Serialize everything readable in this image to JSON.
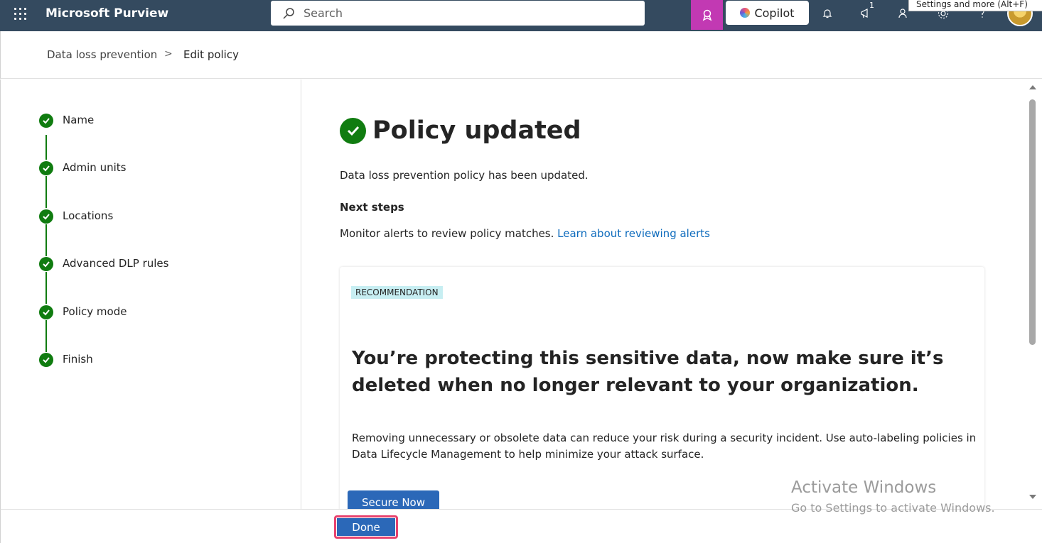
{
  "app": {
    "title": "Microsoft Purview"
  },
  "search": {
    "placeholder": "Search"
  },
  "topbar": {
    "copilot_label": "Copilot",
    "notifications_badge": "1",
    "settings_tooltip": "Settings and more (Alt+F)"
  },
  "breadcrumb": {
    "parent": "Data loss prevention",
    "separator": ">",
    "current": "Edit policy"
  },
  "steps": [
    {
      "label": "Name",
      "status": "complete"
    },
    {
      "label": "Admin units",
      "status": "complete"
    },
    {
      "label": "Locations",
      "status": "complete"
    },
    {
      "label": "Advanced DLP rules",
      "status": "complete"
    },
    {
      "label": "Policy mode",
      "status": "complete"
    },
    {
      "label": "Finish",
      "status": "complete"
    }
  ],
  "main": {
    "title": "Policy updated",
    "updated_text": "Data loss prevention policy has been updated.",
    "next_steps_heading": "Next steps",
    "monitor_text": "Monitor alerts to review policy matches.",
    "monitor_link": "Learn about reviewing alerts"
  },
  "recommendation": {
    "tag": "RECOMMENDATION",
    "heading": "You’re protecting this sensitive data, now make sure it’s deleted when no longer relevant to your organization.",
    "body": "Removing unnecessary or obsolete data can reduce your risk during a security incident. Use auto-labeling policies in Data Lifecycle Management to help minimize your attack surface.",
    "button": "Secure Now"
  },
  "footer": {
    "done_label": "Done"
  },
  "watermark": {
    "line1": "Activate Windows",
    "line2": "Go to Settings to activate Windows."
  },
  "colors": {
    "topbar": "#344a5f",
    "accent_blue": "#2b68b8",
    "success_green": "#107c10",
    "link": "#0f6cbd",
    "highlight_outline": "#e8426e",
    "ribbon_magenta": "#c239b3",
    "tag_bg": "#c7eef2"
  },
  "icons": [
    "app-launcher-icon",
    "search-icon",
    "ribbon-icon",
    "bell-icon",
    "megaphone-icon",
    "people-icon",
    "gear-icon",
    "help-icon",
    "checkmark-icon"
  ]
}
